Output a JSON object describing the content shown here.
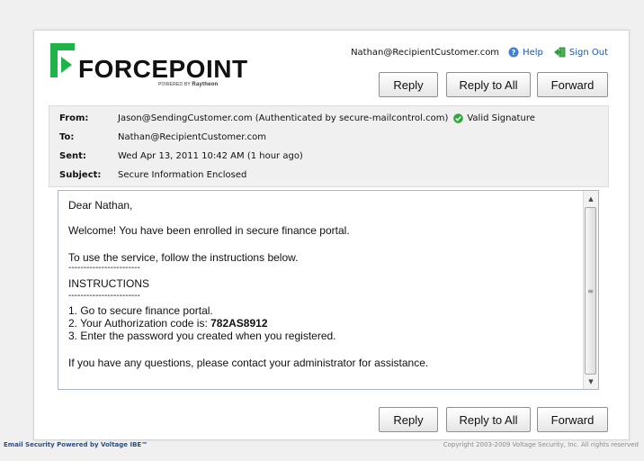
{
  "header": {
    "logo_text": "FORCEPOINT",
    "logo_powered_prefix": "POWERED BY",
    "logo_powered_brand": "Raytheon",
    "recipient": "Nathan@RecipientCustomer.com",
    "help_label": "Help",
    "signout_label": "Sign Out"
  },
  "toolbar": {
    "reply": "Reply",
    "reply_all": "Reply to All",
    "forward": "Forward"
  },
  "meta": {
    "from_label": "From:",
    "from_value": "Jason@SendingCustomer.com (Authenticated by secure-mailcontrol.com)",
    "signature_label": "Valid Signature",
    "to_label": "To:",
    "to_value": "Nathan@RecipientCustomer.com",
    "sent_label": "Sent:",
    "sent_value": "Wed Apr 13, 2011 10:42 AM (1 hour ago)",
    "subject_label": "Subject:",
    "subject_value": "Secure Information Enclosed"
  },
  "message": {
    "greeting": "Dear Nathan,",
    "welcome": "Welcome! You have been enrolled in secure finance portal.",
    "intro": "To use the service, follow the instructions below.",
    "rule": "------------------------",
    "heading": "INSTRUCTIONS",
    "step1": "1. Go to secure finance portal.",
    "step2_prefix": "2. Your Authorization code is: ",
    "auth_code": "782AS8912",
    "step3": "3. Enter the password you created when you registered.",
    "closing": "If you have any questions, please contact your administrator for assistance."
  },
  "footer": {
    "left": "Email Security Powered by Voltage IBE™",
    "right": "Copyright 2003-2009 Voltage Security, Inc. All rights reserved"
  },
  "colors": {
    "brand_green": "#1fb44a",
    "link_blue": "#1f56a8",
    "footer_left": "#2a4f85",
    "footer_right": "#8a8a8a"
  },
  "icons": {
    "help": "help-icon",
    "signout": "sign-out-icon",
    "valid": "check-circle-icon",
    "scroll_up": "chevron-up-icon",
    "scroll_down": "chevron-down-icon"
  }
}
